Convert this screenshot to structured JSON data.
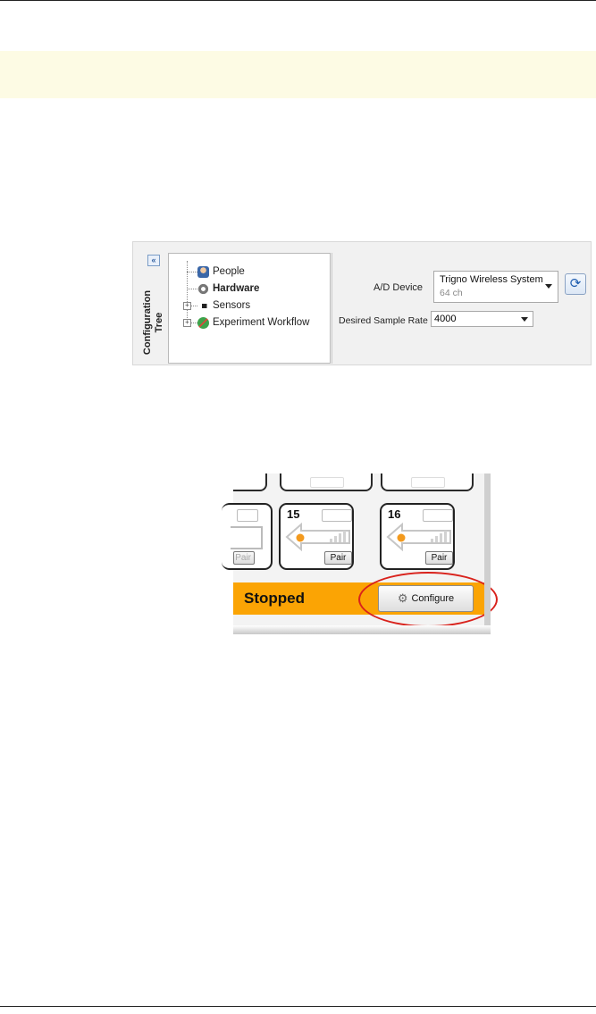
{
  "config_panel": {
    "collapse_glyph": "«",
    "vertical_tab_label": "Configuration Tree",
    "tree_items": [
      {
        "label": "People",
        "icon": "person-icon"
      },
      {
        "label": "Hardware",
        "icon": "gear-icon"
      },
      {
        "label": "Sensors",
        "icon": "sensor-icon"
      },
      {
        "label": "Experiment Workflow",
        "icon": "workflow-icon"
      }
    ],
    "ad_device_label": "A/D Device",
    "ad_device_value": "Trigno Wireless System",
    "ad_device_sub": "64 ch",
    "sample_rate_label": "Desired Sample Rate",
    "sample_rate_value": "4000"
  },
  "sensor_panel": {
    "sensors": [
      {
        "number": "15",
        "pair_label": "Pair"
      },
      {
        "number": "16",
        "pair_label": "Pair"
      }
    ],
    "partial_pair_label": "Pair",
    "status_text": "Stopped",
    "configure_label": "Configure",
    "colors": {
      "status_bar": "#fba404",
      "highlight_ellipse": "#d9221c",
      "sensor_dot": "#f39a1e"
    }
  }
}
